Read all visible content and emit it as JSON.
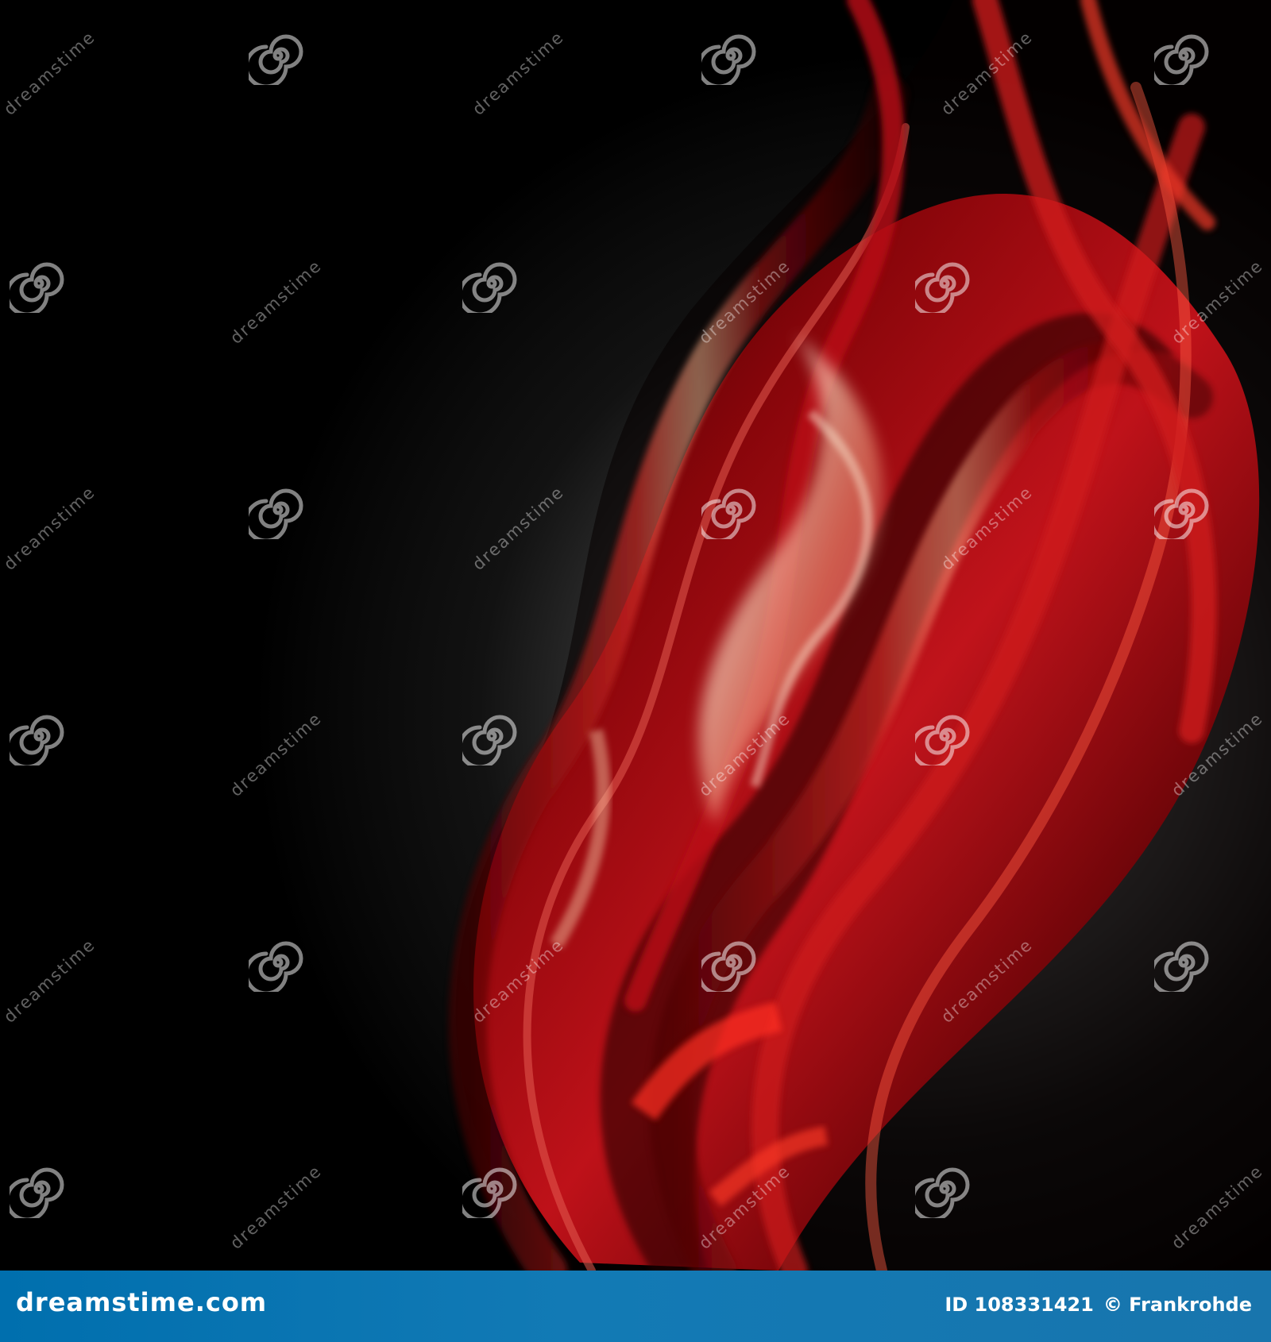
{
  "watermark": {
    "repeated_text": "dreamstime"
  },
  "footer": {
    "site_label": "dreamstime.com",
    "id_label": "ID 108331421",
    "copyright_label": "© Frankrohde"
  },
  "colors": {
    "background": "#000000",
    "primary_red": "#c0141a",
    "deep_red": "#6a0408",
    "highlight": "#f2d0b0",
    "footer_blue": "#0d75b2"
  }
}
